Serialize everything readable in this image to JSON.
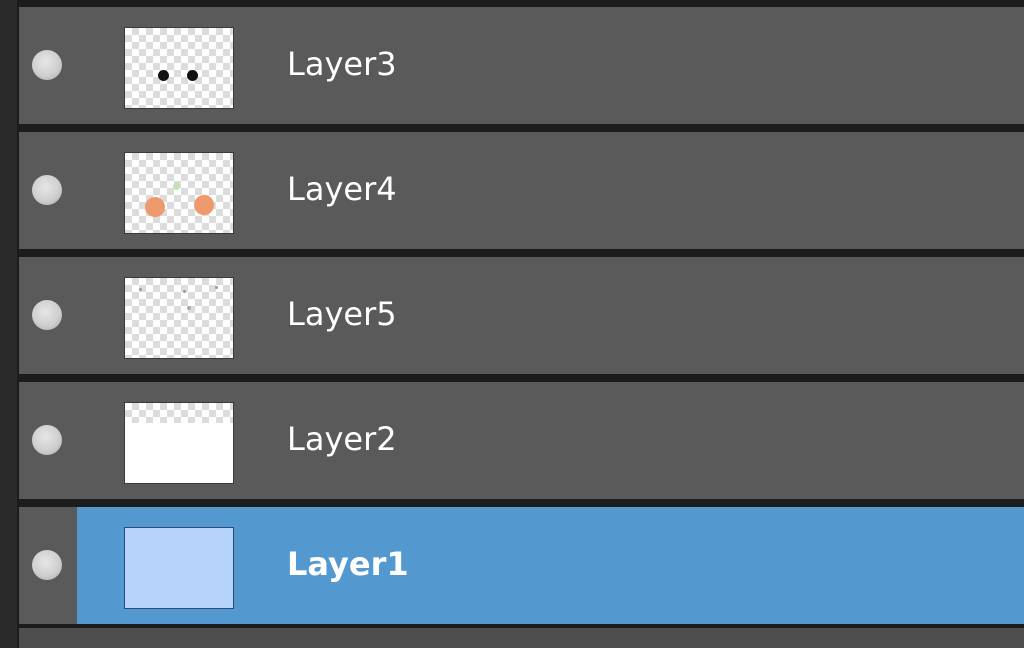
{
  "layers_panel": {
    "layers": [
      {
        "name": "Layer3",
        "thumbnail": "eyes-thumbnail",
        "selected": false
      },
      {
        "name": "Layer4",
        "thumbnail": "cheeks-thumbnail",
        "selected": false
      },
      {
        "name": "Layer5",
        "thumbnail": "sketch-thumbnail",
        "selected": false
      },
      {
        "name": "Layer2",
        "thumbnail": "white-fill-thumbnail",
        "selected": false
      },
      {
        "name": "Layer1",
        "thumbnail": "blue-fill-thumbnail",
        "selected": true
      }
    ],
    "colors": {
      "row_bg": "#5a5a5a",
      "selected_bg": "#5399cf",
      "panel_bg": "#1c1c1c"
    }
  }
}
